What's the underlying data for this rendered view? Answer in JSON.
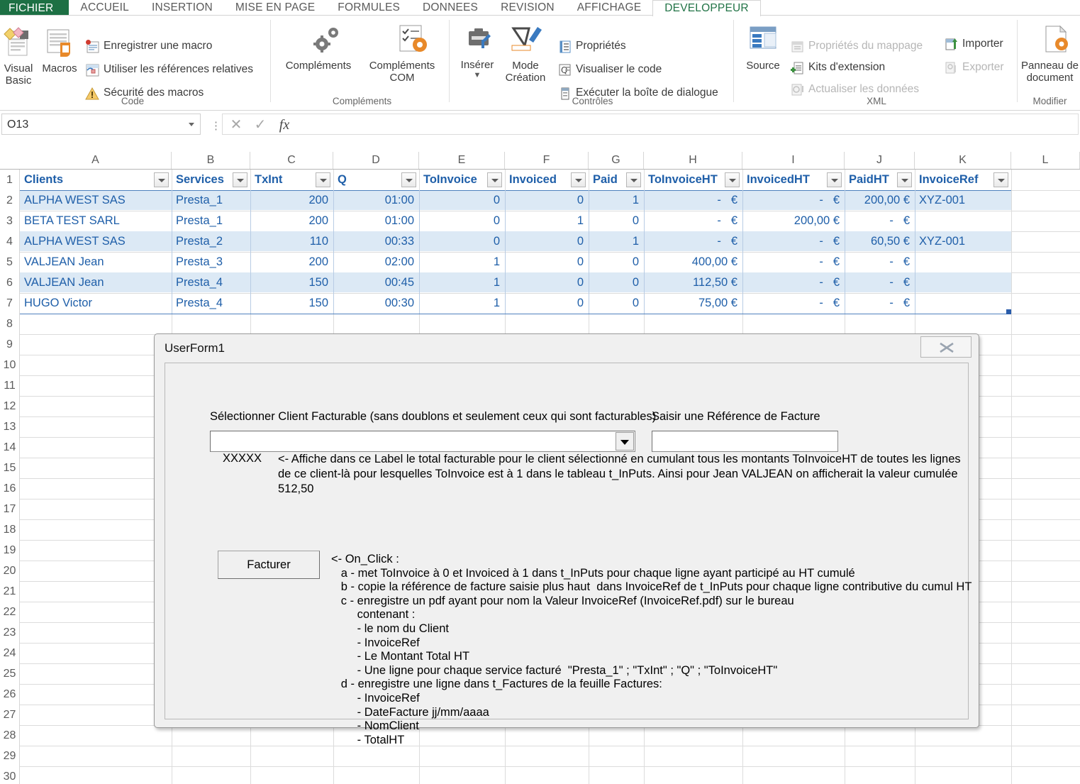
{
  "ribbon": {
    "tabs": [
      {
        "label": "FICHIER",
        "kind": "file"
      },
      {
        "label": "ACCUEIL",
        "kind": "normal"
      },
      {
        "label": "INSERTION",
        "kind": "normal"
      },
      {
        "label": "MISE EN PAGE",
        "kind": "normal"
      },
      {
        "label": "FORMULES",
        "kind": "normal"
      },
      {
        "label": "DONNEES",
        "kind": "normal"
      },
      {
        "label": "REVISION",
        "kind": "normal"
      },
      {
        "label": "AFFICHAGE",
        "kind": "normal"
      },
      {
        "label": "DEVELOPPEUR",
        "kind": "active"
      }
    ],
    "groups": {
      "code": {
        "label": "Code",
        "visual_basic": "Visual\nBasic",
        "macros": "Macros",
        "items": [
          {
            "label": "Enregistrer une macro",
            "icon": "record-macro-icon",
            "disabled": false
          },
          {
            "label": "Utiliser les références relatives",
            "icon": "relative-references-icon",
            "disabled": false
          },
          {
            "label": "Sécurité des macros",
            "icon": "macro-security-icon",
            "disabled": false
          }
        ]
      },
      "complements": {
        "label": "Compléments",
        "addins": "Compléments",
        "com_addins": "Compléments\nCOM"
      },
      "controls": {
        "label": "Contrôles",
        "insert": "Insérer",
        "design_mode": "Mode\nCréation",
        "items": [
          {
            "label": "Propriétés",
            "icon": "properties-icon",
            "disabled": false
          },
          {
            "label": "Visualiser le code",
            "icon": "view-code-icon",
            "disabled": false
          },
          {
            "label": "Exécuter la boîte de dialogue",
            "icon": "run-dialog-icon",
            "disabled": false
          }
        ]
      },
      "xml": {
        "label": "XML",
        "source": "Source",
        "items": [
          {
            "label": "Propriétés du mappage",
            "icon": "map-properties-icon",
            "disabled": true
          },
          {
            "label": "Kits d'extension",
            "icon": "expansion-packs-icon",
            "disabled": false
          },
          {
            "label": "Actualiser les données",
            "icon": "refresh-data-icon",
            "disabled": true
          },
          {
            "label": "Importer",
            "icon": "import-icon",
            "disabled": false
          },
          {
            "label": "Exporter",
            "icon": "export-icon",
            "disabled": true
          }
        ]
      },
      "modify": {
        "label": "Modifier",
        "doc_panel": "Panneau de\ndocument"
      }
    }
  },
  "formula_bar": {
    "name_box": "O13",
    "formula": "",
    "cancel_icon": "cancel-icon",
    "confirm_icon": "confirm-icon",
    "function_icon": "fx-icon"
  },
  "grid": {
    "columns": [
      "A",
      "B",
      "C",
      "D",
      "E",
      "F",
      "G",
      "H",
      "I",
      "J",
      "K",
      "L"
    ],
    "rows": [
      1,
      2,
      3,
      4,
      5,
      6,
      7,
      8,
      9,
      10,
      11,
      12,
      13,
      14,
      15,
      16,
      17,
      18,
      19,
      20,
      21,
      22,
      23,
      24,
      25,
      26,
      27,
      28,
      29,
      30
    ],
    "table_headers": [
      "Clients",
      "Services",
      "TxInt",
      "Q",
      "ToInvoice",
      "Invoiced",
      "Paid",
      "ToInvoiceHT",
      "InvoicedHT",
      "PaidHT",
      "InvoiceRef"
    ],
    "table_rows": [
      {
        "Clients": "ALPHA WEST SAS",
        "Services": "Presta_1",
        "TxInt": "200",
        "Q": "01:00",
        "ToInvoice": "0",
        "Invoiced": "0",
        "Paid": "1",
        "ToInvoiceHT": "-",
        "ToInvoiceHTCur": "€",
        "InvoicedHT": "-",
        "InvoicedHTCur": "€",
        "PaidHT": "200,00 €",
        "InvoiceRef": "XYZ-001"
      },
      {
        "Clients": "BETA TEST SARL",
        "Services": "Presta_1",
        "TxInt": "200",
        "Q": "01:00",
        "ToInvoice": "0",
        "Invoiced": "1",
        "Paid": "0",
        "ToInvoiceHT": "-",
        "ToInvoiceHTCur": "€",
        "InvoicedHT": "200,00 €",
        "InvoicedHTCur": "",
        "PaidHT": "-",
        "PaidHTCur": "€",
        "InvoiceRef": ""
      },
      {
        "Clients": "ALPHA WEST SAS",
        "Services": "Presta_2",
        "TxInt": "110",
        "Q": "00:33",
        "ToInvoice": "0",
        "Invoiced": "0",
        "Paid": "1",
        "ToInvoiceHT": "-",
        "ToInvoiceHTCur": "€",
        "InvoicedHT": "-",
        "InvoicedHTCur": "€",
        "PaidHT": "60,50 €",
        "InvoiceRef": "XYZ-001"
      },
      {
        "Clients": "VALJEAN Jean",
        "Services": "Presta_3",
        "TxInt": "200",
        "Q": "02:00",
        "ToInvoice": "1",
        "Invoiced": "0",
        "Paid": "0",
        "ToInvoiceHT": "400,00 €",
        "ToInvoiceHTCur": "",
        "InvoicedHT": "-",
        "InvoicedHTCur": "€",
        "PaidHT": "-",
        "PaidHTCur": "€",
        "InvoiceRef": ""
      },
      {
        "Clients": "VALJEAN Jean",
        "Services": "Presta_4",
        "TxInt": "150",
        "Q": "00:45",
        "ToInvoice": "1",
        "Invoiced": "0",
        "Paid": "0",
        "ToInvoiceHT": "112,50 €",
        "ToInvoiceHTCur": "",
        "InvoicedHT": "-",
        "InvoicedHTCur": "€",
        "PaidHT": "-",
        "PaidHTCur": "€",
        "InvoiceRef": ""
      },
      {
        "Clients": "HUGO Victor",
        "Services": "Presta_4",
        "TxInt": "150",
        "Q": "00:30",
        "ToInvoice": "1",
        "Invoiced": "0",
        "Paid": "0",
        "ToInvoiceHT": "75,00 €",
        "ToInvoiceHTCur": "",
        "InvoicedHT": "-",
        "InvoicedHTCur": "€",
        "PaidHT": "-",
        "PaidHTCur": "€",
        "InvoiceRef": ""
      }
    ]
  },
  "userform": {
    "title": "UserForm1",
    "close_icon": "close-icon",
    "combo_label": "Sélectionner Client Facturable (sans doublons et seulement ceux qui sont facturables)",
    "combo_value": "",
    "ref_label": "Saisir une Référence de Facture",
    "ref_value": "",
    "total_placeholder": "XXXXX",
    "description": "<- Affiche dans ce Label le total facturable pour le client sélectionné en cumulant tous les montants ToInvoiceHT de toutes les lignes de ce client-là pour lesquelles ToInvoice est à 1 dans le tableau t_InPuts. Ainsi pour Jean VALJEAN on afficherait la valeur cumulée 512,50",
    "button_label": "Facturer",
    "steps": "<- On_Click :\n   a - met ToInvoice à 0 et Invoiced à 1 dans t_InPuts pour chaque ligne ayant participé au HT cumulé\n   b - copie la référence de facture saisie plus haut  dans InvoiceRef de t_InPuts pour chaque ligne contributive du cumul HT\n   c - enregistre un pdf ayant pour nom la Valeur InvoiceRef (InvoiceRef.pdf) sur le bureau\n        contenant :\n        - le nom du Client\n        - InvoiceRef\n        - Le Montant Total HT\n        - Une ligne pour chaque service facturé  \"Presta_1\" ; \"TxInt\" ; \"Q\" ; \"ToInvoiceHT\"\n   d - enregistre une ligne dans t_Factures de la feuille Factures:\n        - InvoiceRef\n        - DateFacture jj/mm/aaaa\n        - NomClient\n        - TotalHT"
  },
  "colors": {
    "excel_green": "#1d7044",
    "tab_active": "#217346",
    "table_text": "#1f5fa9",
    "band": "#dce9f5",
    "table_border": "#4f81bd"
  }
}
